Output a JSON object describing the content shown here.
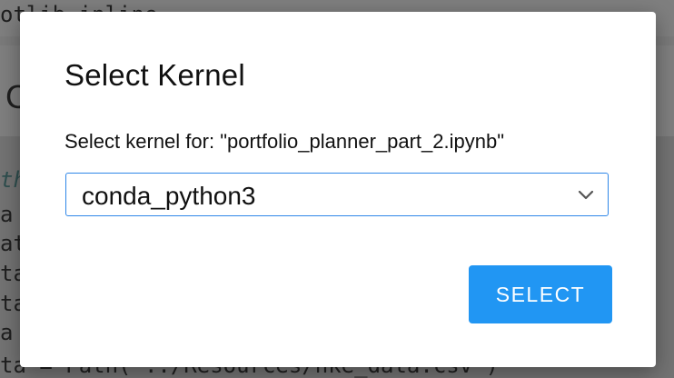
{
  "background": {
    "lines": [
      "otlib inline",
      "",
      "C",
      "th",
      "a",
      "at",
      "ta",
      "ta",
      "a",
      "ta = Path(\"../Resources/nke_data.csv\")"
    ]
  },
  "dialog": {
    "title": "Select Kernel",
    "subtitle": "Select kernel for: \"portfolio_planner_part_2.ipynb\"",
    "kernel_select": {
      "selected": "conda_python3"
    },
    "select_button_label": "SELECT"
  },
  "colors": {
    "accent": "#2196f3",
    "select_border": "#2f87e8",
    "overlay": "#7a7a7a"
  },
  "icons": {
    "dropdown": "chevron-down-icon"
  }
}
